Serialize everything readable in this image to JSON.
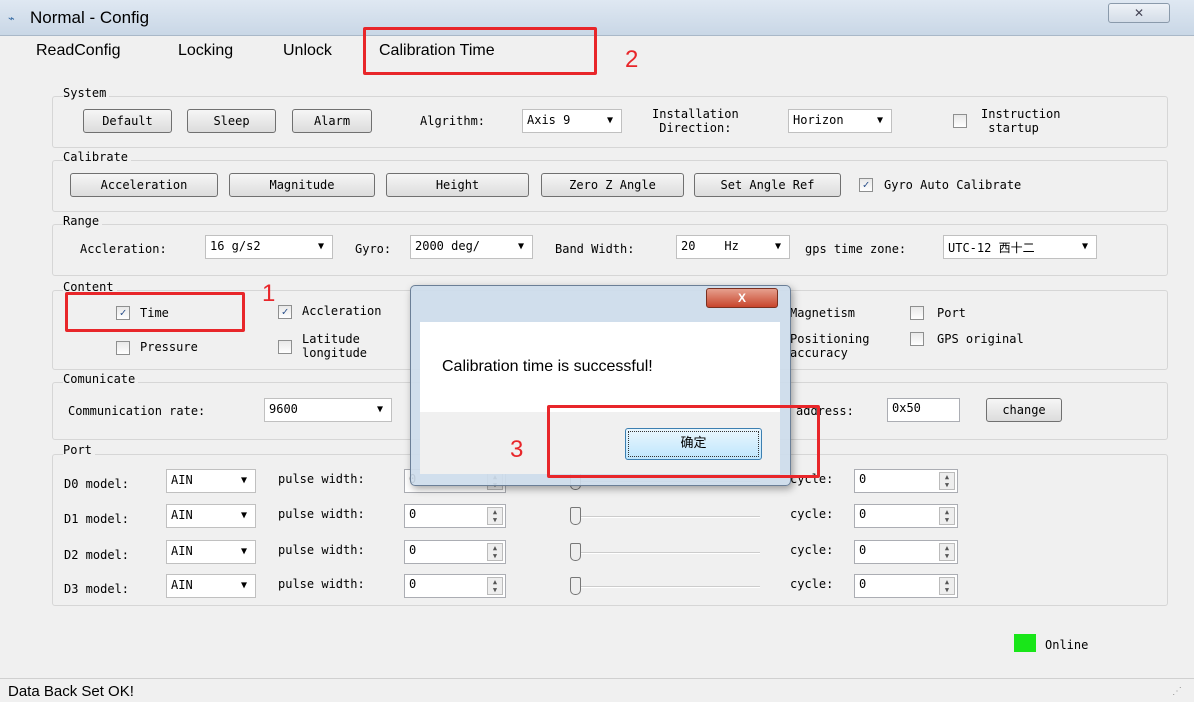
{
  "window": {
    "title": "Normal - Config",
    "close": "✕"
  },
  "menu": [
    "ReadConfig",
    "Locking",
    "Unlock",
    "Calibration Time"
  ],
  "system": {
    "label": "System",
    "buttons": [
      "Default",
      "Sleep",
      "Alarm"
    ],
    "algorithm_label": "Algrithm:",
    "algorithm_value": "Axis 9",
    "direction_label_1": "Installation",
    "direction_label_2": "Direction:",
    "direction_value": "Horizon",
    "instruction_label_1": "Instruction",
    "instruction_label_2": "startup",
    "instruction_checked": false
  },
  "calibrate": {
    "label": "Calibrate",
    "buttons": [
      "Acceleration",
      "Magnitude",
      "Height",
      "Zero Z Angle",
      "Set Angle Ref"
    ],
    "gyro_label": "Gyro Auto Calibrate",
    "gyro_checked": true
  },
  "range": {
    "label": "Range",
    "accel_label": "Accleration:",
    "accel_value": "16 g/s2",
    "gyro_label": "Gyro:",
    "gyro_value": "2000 deg/",
    "bw_label": "Band Width:",
    "bw_value": "20",
    "bw_unit": "Hz",
    "tz_label": "gps time zone:",
    "tz_value": "UTC-12 西十二"
  },
  "content": {
    "label": "Content",
    "time": "Time",
    "accel": "Accleration",
    "magnetism": "Magnetism",
    "port": "Port",
    "pressure": "Pressure",
    "lat1": "Latitude",
    "lat2": "longitude",
    "pos1": "Positioning",
    "pos2": "accuracy",
    "gps": "GPS original"
  },
  "comm": {
    "label": "Comunicate",
    "rate_label": "Communication rate:",
    "rate_value": "9600",
    "address_label": "address:",
    "address_value": "0x50",
    "change": "change"
  },
  "port": {
    "label": "Port",
    "rows": [
      {
        "model": "D0 model:",
        "model_value": "AIN",
        "pw_label": "pulse width:",
        "pw": "0",
        "cycle_label": "cycle:",
        "cycle": "0"
      },
      {
        "model": "D1 model:",
        "model_value": "AIN",
        "pw_label": "pulse width:",
        "pw": "0",
        "cycle_label": "cycle:",
        "cycle": "0"
      },
      {
        "model": "D2 model:",
        "model_value": "AIN",
        "pw_label": "pulse width:",
        "pw": "0",
        "cycle_label": "cycle:",
        "cycle": "0"
      },
      {
        "model": "D3 model:",
        "model_value": "AIN",
        "pw_label": "pulse width:",
        "pw": "0",
        "cycle_label": "cycle:",
        "cycle": "0"
      }
    ]
  },
  "status": {
    "online": "Online",
    "online_color": "#19e619",
    "bar": "Data Back Set OK!"
  },
  "dialog": {
    "message": "Calibration time is successful!",
    "ok": "确定",
    "close": "X"
  },
  "annotations": [
    "1",
    "2",
    "3"
  ]
}
